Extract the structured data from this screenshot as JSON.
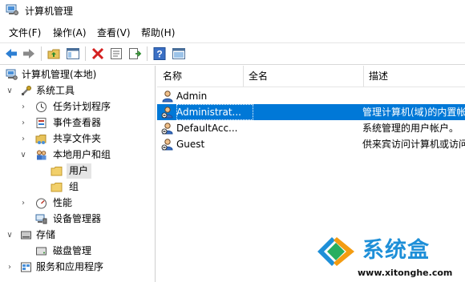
{
  "window": {
    "title": "计算机管理"
  },
  "menu": [
    {
      "label": "文件(F)"
    },
    {
      "label": "操作(A)"
    },
    {
      "label": "查看(V)"
    },
    {
      "label": "帮助(H)"
    }
  ],
  "toolbar": {
    "icons": [
      "back-arrow-icon",
      "forward-arrow-icon",
      "up-folder-icon",
      "show-hide-tree-icon",
      "delete-icon",
      "properties-icon",
      "export-list-icon",
      "help-icon",
      "show-hide-action-pane-icon"
    ]
  },
  "tree": [
    {
      "label": "计算机管理(本地)",
      "level": 0,
      "arrow": "",
      "icon": "computer-management-icon"
    },
    {
      "label": "系统工具",
      "level": 1,
      "arrow": "expanded",
      "icon": "system-tools-icon"
    },
    {
      "label": "任务计划程序",
      "level": 2,
      "arrow": "collapsed",
      "icon": "clock-icon"
    },
    {
      "label": "事件查看器",
      "level": 2,
      "arrow": "collapsed",
      "icon": "event-viewer-icon"
    },
    {
      "label": "共享文件夹",
      "level": 2,
      "arrow": "collapsed",
      "icon": "shared-folder-icon"
    },
    {
      "label": "本地用户和组",
      "level": 2,
      "arrow": "expanded",
      "icon": "users-groups-icon"
    },
    {
      "label": "用户",
      "level": 3,
      "arrow": "",
      "icon": "folder-icon",
      "selected": true
    },
    {
      "label": "组",
      "level": 3,
      "arrow": "",
      "icon": "folder-icon"
    },
    {
      "label": "性能",
      "level": 2,
      "arrow": "collapsed",
      "icon": "performance-icon"
    },
    {
      "label": "设备管理器",
      "level": 2,
      "arrow": "",
      "icon": "device-manager-icon"
    },
    {
      "label": "存储",
      "level": 1,
      "arrow": "expanded",
      "icon": "storage-icon"
    },
    {
      "label": "磁盘管理",
      "level": 2,
      "arrow": "",
      "icon": "disk-management-icon"
    },
    {
      "label": "服务和应用程序",
      "level": 1,
      "arrow": "collapsed",
      "icon": "services-apps-icon"
    }
  ],
  "list": {
    "columns": [
      "名称",
      "全名",
      "描述"
    ],
    "rows": [
      {
        "name": "Admin",
        "fullname": "",
        "desc": "",
        "selected": false,
        "disabled": false
      },
      {
        "name": "Administrat...",
        "fullname": "",
        "desc": "管理计算机(域)的内置帐",
        "selected": true,
        "disabled": true
      },
      {
        "name": "DefaultAcc...",
        "fullname": "",
        "desc": "系统管理的用户帐户。",
        "selected": false,
        "disabled": true
      },
      {
        "name": "Guest",
        "fullname": "",
        "desc": "供来宾访问计算机或访问",
        "selected": false,
        "disabled": true
      }
    ]
  },
  "watermark": {
    "name": "系统盒",
    "url": "www.xitonghe.com"
  },
  "colors": {
    "selection": "#0078d7",
    "tree_selected": "#e5e5e5"
  }
}
